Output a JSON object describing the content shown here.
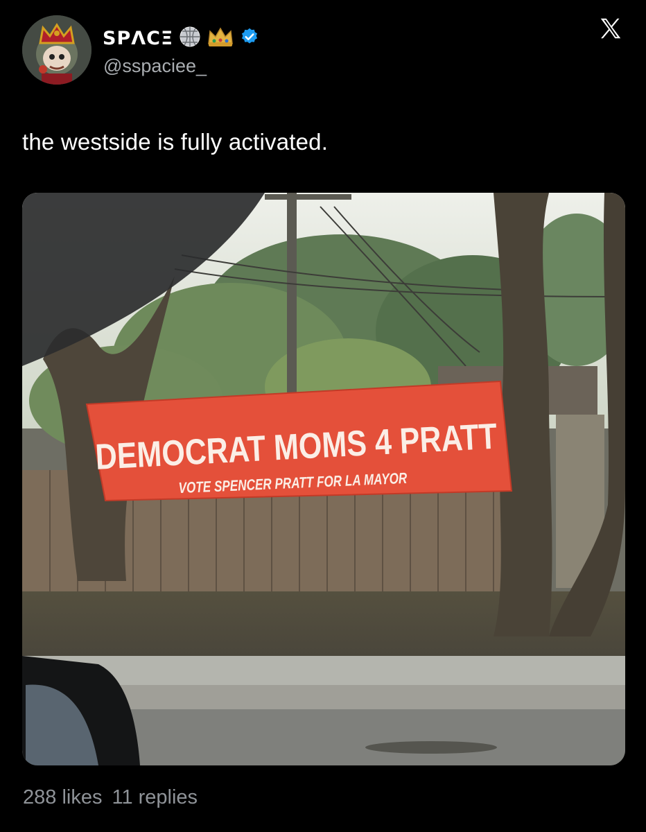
{
  "post": {
    "author": {
      "display_name": "SPΛCΞ",
      "handle": "@sspaciee_",
      "badges": [
        "disco-ball-emoji",
        "crown-emoji",
        "verified-badge"
      ]
    },
    "platform_icon": "x-logo-icon",
    "text": "the westside is fully activated.",
    "photo": {
      "banner_title": "DEMOCRAT MOMS 4 PRATT",
      "banner_subtitle": "VOTE SPENCER PRATT FOR LA MAYOR"
    },
    "stats": {
      "likes": "288 likes",
      "replies": "11 replies"
    }
  },
  "colors": {
    "background": "#000000",
    "verified": "#1d9bf0",
    "banner": "#e4503a"
  }
}
